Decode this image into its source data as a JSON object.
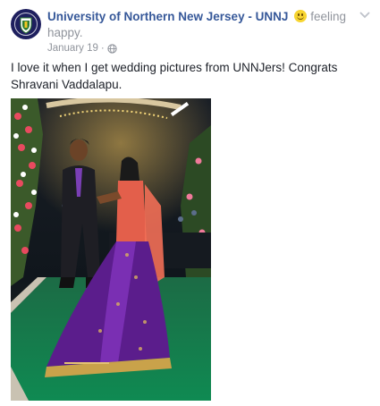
{
  "post": {
    "page_name": "University of Northern New Jersey - UNNJ",
    "feeling_prefix": "feeling",
    "feeling_suffix": "happy.",
    "timestamp": "January 19",
    "separator": "·",
    "audience_icon": "globe-icon",
    "text": "I love it when I get wedding pictures from UNNJers! Congrats Shravani Vaddalapu."
  },
  "colors": {
    "link_blue": "#365899",
    "meta_gray": "#90949c",
    "text": "#1d2129"
  },
  "icons": {
    "avatar": "university-seal-icon",
    "feeling": "smiley-icon",
    "menu": "chevron-down-icon"
  }
}
